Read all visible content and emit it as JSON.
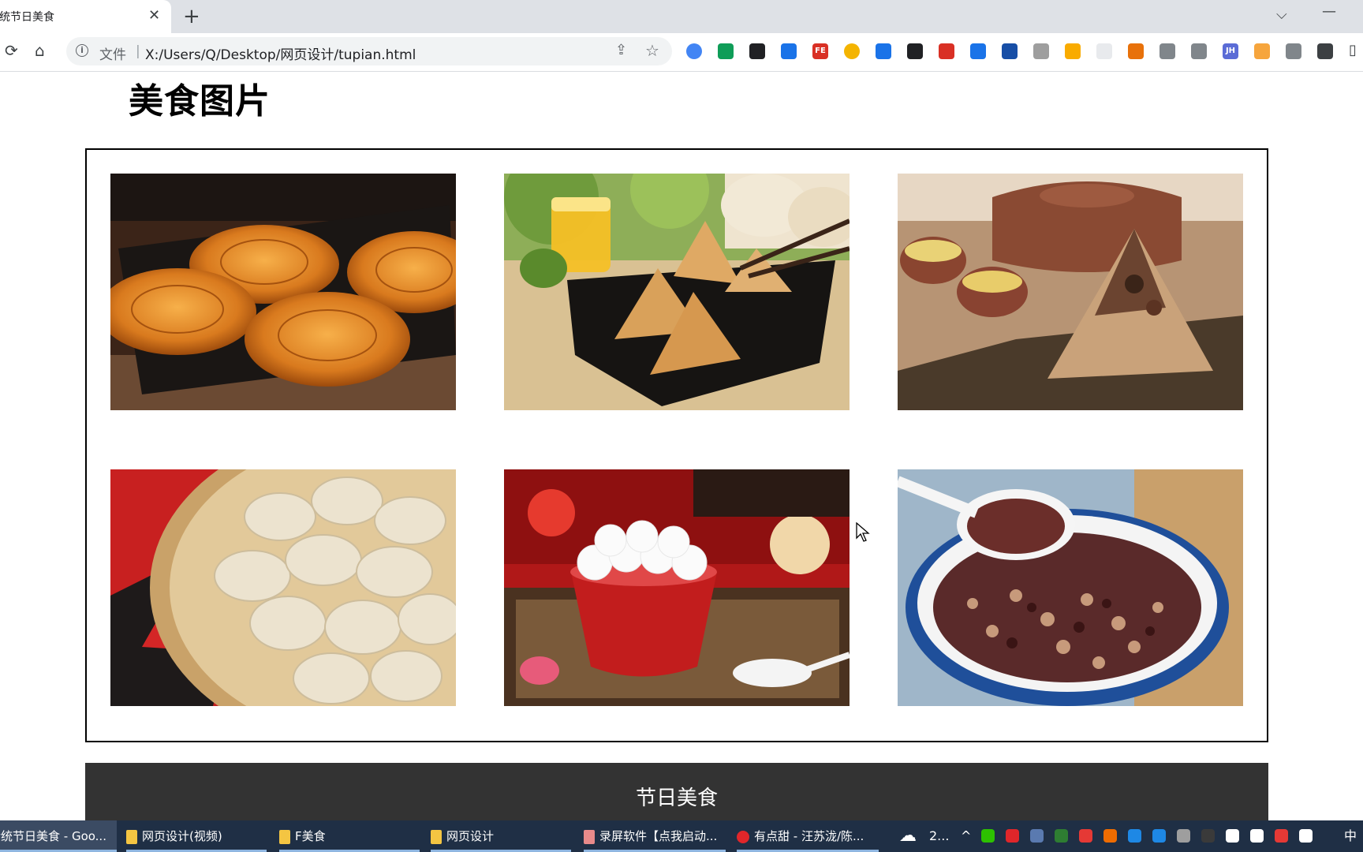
{
  "browser": {
    "tab_title": "传统节日美食",
    "new_tab_icon": "plus",
    "security_label": "文件",
    "url": "X:/Users/Q/Desktop/网页设计/tupian.html",
    "extensions": [
      {
        "name": "chrome-ext-1",
        "color": "#4285f4",
        "glyph": ""
      },
      {
        "name": "shield-ext",
        "color": "#0f9d58",
        "glyph": ""
      },
      {
        "name": "arrow-ext",
        "color": "#202124",
        "glyph": ""
      },
      {
        "name": "search-ext",
        "color": "#1a73e8",
        "glyph": ""
      },
      {
        "name": "fe-ext",
        "color": "#d93025",
        "glyph": "FE"
      },
      {
        "name": "chrome-ext-2",
        "color": "#f4b400",
        "glyph": ""
      },
      {
        "name": "download-ext",
        "color": "#1a73e8",
        "glyph": ""
      },
      {
        "name": "github-ext",
        "color": "#202124",
        "glyph": ""
      },
      {
        "name": "stop-ext",
        "color": "#d93025",
        "glyph": ""
      },
      {
        "name": "g-ext",
        "color": "#1a73e8",
        "glyph": ""
      },
      {
        "name": "y-ext",
        "color": "#174ea6",
        "glyph": ""
      },
      {
        "name": "owl-ext",
        "color": "#9e9e9e",
        "glyph": ""
      },
      {
        "name": "yellow-ext",
        "color": "#f9ab00",
        "glyph": ""
      },
      {
        "name": "blank-ext",
        "color": "#e8eaed",
        "glyph": ""
      },
      {
        "name": "tree-ext",
        "color": "#e8710a",
        "glyph": ""
      },
      {
        "name": "cloud-ext",
        "color": "#80868b",
        "glyph": ""
      },
      {
        "name": "camera-ext",
        "color": "#80868b",
        "glyph": ""
      },
      {
        "name": "jh-ext",
        "color": "#5b6cd6",
        "glyph": "JH"
      },
      {
        "name": "orange-ext",
        "color": "#f6a53d",
        "glyph": ""
      },
      {
        "name": "gear-ext",
        "color": "#80868b",
        "glyph": ""
      },
      {
        "name": "puzzle-ext",
        "color": "#3c4043",
        "glyph": ""
      }
    ]
  },
  "page": {
    "title": "美食图片",
    "photos": [
      {
        "name": "mooncake-photo",
        "bg": "#7a3e12",
        "subject": "mooncake"
      },
      {
        "name": "zongzi-photo",
        "bg": "#c9a56a",
        "subject": "zongzi-plate"
      },
      {
        "name": "zongzi-tea-photo",
        "bg": "#8c5a3a",
        "subject": "zongzi-tea"
      },
      {
        "name": "dumpling-photo",
        "bg": "#d8c8a8",
        "subject": "dumpling"
      },
      {
        "name": "tangyuan-photo",
        "bg": "#9e1b1b",
        "subject": "tangyuan"
      },
      {
        "name": "laba-porridge-photo",
        "bg": "#5b7fa8",
        "subject": "porridge"
      }
    ],
    "footer_text": "节日美食"
  },
  "taskbar": {
    "items": [
      {
        "label": "传统节日美食 - Goo..."
      },
      {
        "label": "网页设计(视频)"
      },
      {
        "label": "F美食"
      },
      {
        "label": "网页设计"
      },
      {
        "label": "录屏软件【点我启动..."
      },
      {
        "label": "有点甜 - 汪苏泷/陈..."
      }
    ],
    "tray_weather": "2...",
    "tray_ime": "中"
  }
}
